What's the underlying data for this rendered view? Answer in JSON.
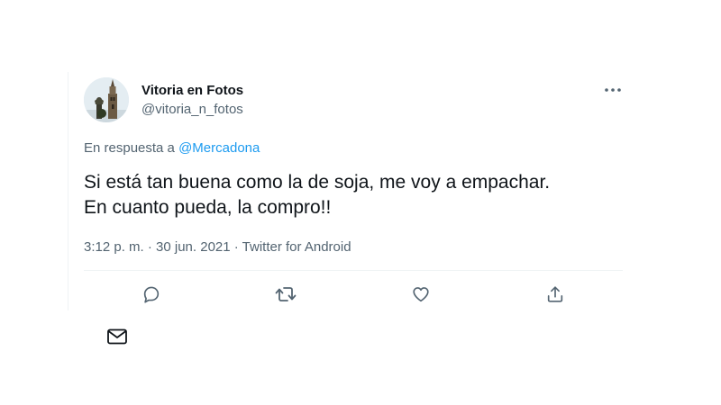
{
  "tweet": {
    "author_name": "Vitoria en Fotos",
    "author_handle": "@vitoria_n_fotos",
    "reply_prefix": "En respuesta a",
    "reply_mention": "@Mercadona",
    "text_line1": "Si está tan buena como la de soja, me voy a empachar.",
    "text_line2": "En cuanto pueda, la compro!!",
    "meta": "3:12 p. m. · 30 jun. 2021 · Twitter for Android"
  },
  "colors": {
    "text": "#0f1419",
    "secondary": "#536471",
    "link": "#1d9bf0",
    "divider": "#eff3f4"
  },
  "icons": [
    "more-icon",
    "reply-icon",
    "retweet-icon",
    "like-icon",
    "share-icon",
    "mail-icon"
  ]
}
